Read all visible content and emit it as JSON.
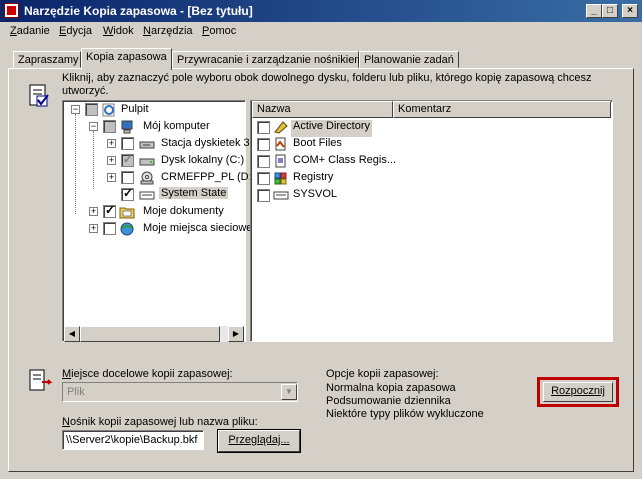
{
  "window": {
    "title": "Narzędzie Kopia zapasowa - [Bez tytułu]",
    "min": "_",
    "max": "□",
    "close": "×"
  },
  "menu": [
    {
      "first": "Z",
      "rest": "adanie"
    },
    {
      "first": "E",
      "rest": "dycja"
    },
    {
      "first": "W",
      "rest": "idok"
    },
    {
      "first": "N",
      "rest": "arzędzia"
    },
    {
      "first": "P",
      "rest": "omoc"
    }
  ],
  "tabs": [
    "Zapraszamy",
    "Kopia zapasowa",
    "Przywracanie i zarządzanie nośnikiem",
    "Planowanie zadań"
  ],
  "instruction": "Kliknij, aby zaznaczyć pole wyboru obok dowolnego dysku, folderu lub pliku, którego kopię zapasową chcesz utworzyć.",
  "tree": {
    "items": [
      {
        "label": "Pulpit",
        "expander": "−",
        "checked": false,
        "gray": true
      },
      {
        "label": "Mój komputer",
        "expander": "−",
        "checked": false,
        "gray": true
      },
      {
        "label": "Stacja dyskietek 3",
        "expander": "+",
        "checked": false,
        "gray": false
      },
      {
        "label": "Dysk lokalny (C:)",
        "expander": "+",
        "checked": true,
        "gray": true
      },
      {
        "label": "CRMEFPP_PL (D:",
        "expander": "+",
        "checked": false,
        "gray": false
      },
      {
        "label": "System State",
        "expander": "",
        "checked": true,
        "gray": false
      },
      {
        "label": "Moje dokumenty",
        "expander": "+",
        "checked": true,
        "gray": false
      },
      {
        "label": "Moje miejsca sieciowe",
        "expander": "+",
        "checked": false,
        "gray": false
      }
    ]
  },
  "list": {
    "columns": [
      "Nazwa",
      "Komentarz"
    ],
    "rows": [
      "Active Directory",
      "Boot Files",
      "COM+ Class Regis...",
      "Registry",
      "SYSVOL"
    ]
  },
  "destination": {
    "label_first": "M",
    "label_rest": "iejsce docelowe kopii zapasowej:",
    "value": "Plik",
    "media_label_first": "N",
    "media_label_rest": "ośnik kopii zapasowej lub nazwa pliku:",
    "media_value": "\\\\Server2\\kopie\\Backup.bkf",
    "browse": "Przeglądaj..."
  },
  "options": {
    "title": "Opcje kopii zapasowej:",
    "lines": [
      "Normalna kopia zapasowa",
      "Podsumowanie dziennika",
      "Niektóre typy plików wykluczone"
    ]
  },
  "start_button": "Rozpocznij",
  "colors": {
    "highlight_border": "#c00000",
    "title_start": "#0a246a",
    "title_end": "#3a6ea5"
  }
}
